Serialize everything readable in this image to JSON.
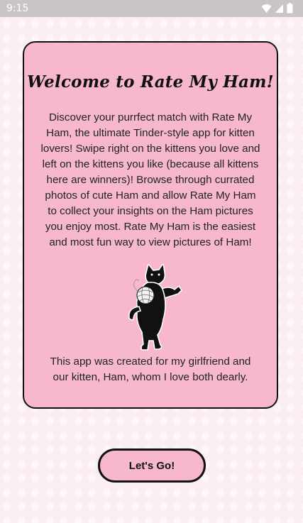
{
  "status_bar": {
    "time": "9:15",
    "icons": [
      "wifi-icon",
      "cellular-signal-icon",
      "battery-icon"
    ]
  },
  "welcome": {
    "title": "Welcome to Rate My Ham!",
    "description": "Discover your purrfect match with Rate My Ham, the ultimate Tinder-style app for kitten lovers! Swipe right on the kittens you love and left on the kittens you like (because all kittens here are winners)! Browse through currated photos of cute Ham and allow Rate My Ham to collect your insights on the Ham pictures you enjoy most. Rate My Ham is the easiest and most fun way to view pictures of Ham!",
    "footer": "This app was created for my girlfriend and our kitten, Ham, whom I love both dearly."
  },
  "actions": {
    "start_label": "Let's Go!"
  },
  "colors": {
    "card_background": "#f7b8cf",
    "page_background": "#fbeef3",
    "border": "#111111"
  }
}
